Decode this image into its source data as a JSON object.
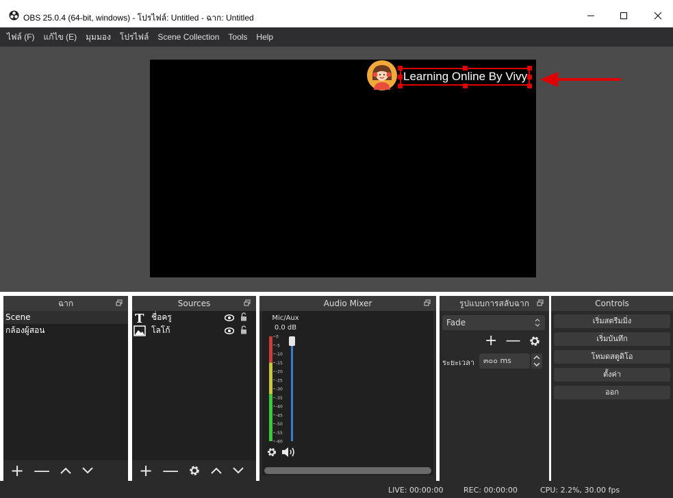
{
  "window": {
    "title": "OBS 25.0.4 (64-bit, windows) - โปรไฟล์: Untitled - ฉาก: Untitled",
    "icon": "obs-logo-icon",
    "controls": [
      "minimize-icon",
      "maximize-icon",
      "close-icon"
    ]
  },
  "menu": {
    "file": "ไฟล์ (F)",
    "edit": "แก้ไข (E)",
    "view": "มุมมอง",
    "profile": "โปรไฟล์",
    "scene_collection": "Scene Collection",
    "tools": "Tools",
    "help": "Help"
  },
  "preview": {
    "text_source": "Learning Online By Vivy"
  },
  "docks": {
    "scenes": {
      "title": "ฉาก",
      "items": [
        "Scene",
        "กล้องผู้สอน"
      ],
      "selected_index": 0
    },
    "sources": {
      "title": "Sources",
      "items": [
        {
          "label": "ชื่อครู",
          "icon": "text-source-icon",
          "visible": true,
          "locked": false
        },
        {
          "label": "โลโก้",
          "icon": "image-source-icon",
          "visible": true,
          "locked": false
        }
      ]
    },
    "mixer": {
      "title": "Audio Mixer",
      "channel": "Mic/Aux",
      "db": "0.0 dB",
      "ticks": [
        "0",
        "-5",
        "-10",
        "-15",
        "-20",
        "-25",
        "-30",
        "-35",
        "-40",
        "-45",
        "-50",
        "-55",
        "-60"
      ],
      "volume_fraction": 1.0
    },
    "transitions": {
      "title": "รูปแบบการสลับฉาก",
      "selected": "Fade",
      "duration_label": "ระยะเวลา",
      "duration_value": "๓๐๐ ms"
    },
    "controls": {
      "title": "Controls",
      "buttons": [
        "เริ่มสตรีมมิ่ง",
        "เริ่มบันทึก",
        "โหมดสตูดิโอ",
        "ตั้งค่า",
        "ออก"
      ]
    }
  },
  "status": {
    "live": "LIVE: 00:00:00",
    "rec": "REC: 00:00:00",
    "cpu": "CPU: 2.2%, 30.00 fps"
  },
  "colors": {
    "selection": "#e00000",
    "arrow": "#e00000",
    "meter_green": "#3ec83e",
    "meter_yellow": "#c8c83e",
    "meter_red": "#c83e3e",
    "volume_slider": "#3a7fd0"
  }
}
